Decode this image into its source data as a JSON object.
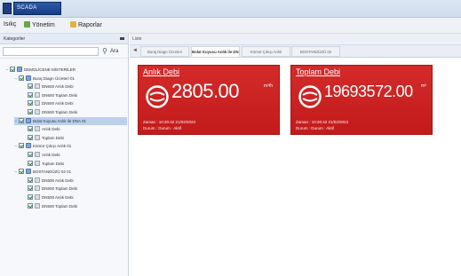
{
  "app": {
    "logo_text": "SCADA"
  },
  "menu": {
    "items": [
      {
        "label": "Isıkç"
      },
      {
        "label": "Yönetim"
      },
      {
        "label": "Raporlar"
      }
    ]
  },
  "sidebar": {
    "header": "Kategoriler",
    "search_btn": "Ara",
    "tree": [
      {
        "label": "DEMOLİCENE MİSTERİLER",
        "indent": 0,
        "type": "grp",
        "toggle": "−"
      },
      {
        "label": "Buraj Diagrı Ücreteri 01",
        "indent": 1,
        "type": "grp",
        "toggle": "−"
      },
      {
        "label": "DN600 Anlık Debi",
        "indent": 2,
        "type": "doc",
        "toggle": ""
      },
      {
        "label": "DN600 Toplam Debi",
        "indent": 2,
        "type": "doc",
        "toggle": ""
      },
      {
        "label": "DN500 Anlık Debi",
        "indent": 2,
        "type": "doc",
        "toggle": ""
      },
      {
        "label": "DN500 Toplam Debi",
        "indent": 2,
        "type": "doc",
        "toggle": ""
      },
      {
        "label": "Bolat Kuyusu Anlık ile DNA 01",
        "indent": 1,
        "type": "grp",
        "toggle": "−",
        "selected": true
      },
      {
        "label": "Anlık Debi",
        "indent": 2,
        "type": "doc",
        "toggle": ""
      },
      {
        "label": "Toplam Debi",
        "indent": 2,
        "type": "doc",
        "toggle": ""
      },
      {
        "label": "Kömür Çıkışı Anlık 01",
        "indent": 1,
        "type": "grp",
        "toggle": "−"
      },
      {
        "label": "Anlık Debi",
        "indent": 2,
        "type": "doc",
        "toggle": ""
      },
      {
        "label": "Toplam Debi",
        "indent": 2,
        "type": "doc",
        "toggle": ""
      },
      {
        "label": "BOSTANDÜZÜ 02 01",
        "indent": 1,
        "type": "grp",
        "toggle": "−"
      },
      {
        "label": "DN600 Anlık Debi",
        "indent": 2,
        "type": "doc",
        "toggle": ""
      },
      {
        "label": "DN600 Toplam Debi",
        "indent": 2,
        "type": "doc",
        "toggle": ""
      },
      {
        "label": "DN500 Anlık Debi",
        "indent": 2,
        "type": "doc",
        "toggle": ""
      },
      {
        "label": "DN500 Toplam Debi",
        "indent": 2,
        "type": "doc",
        "toggle": ""
      }
    ]
  },
  "main": {
    "header": "Liste",
    "tabs": [
      {
        "label": "Buraj Diagrı Ücreteri",
        "active": false
      },
      {
        "label": "Bolat Kuyusu Anlık ile DNA",
        "active": true
      },
      {
        "label": "Kömür Çıkışı Anlık",
        "active": false
      },
      {
        "label": "BOSTANDÜZÜ 02",
        "active": false
      }
    ],
    "tiles": [
      {
        "title": "Anlık Debi",
        "value": "2805.00",
        "unit": "m³/h",
        "date_line": "Zaman : 10:20:42 21/02/2023",
        "status_line": "Durum : Durum : Aktif",
        "color": "#d42a2a"
      },
      {
        "title": "Toplam Debi",
        "value": "19693572.00",
        "unit": "m³",
        "date_line": "Zaman : 10:20:42 21/02/2023",
        "status_line": "Durum : Durum : Aktif",
        "color": "#d42a2a"
      }
    ]
  },
  "colors": {
    "tile_red": "#d42a2a",
    "selection": "#bcd0ee",
    "titlebar": "#d6e2f2"
  },
  "icons": {
    "window": "app-icon",
    "gauge": "gauge-icon",
    "search": "search-icon"
  }
}
